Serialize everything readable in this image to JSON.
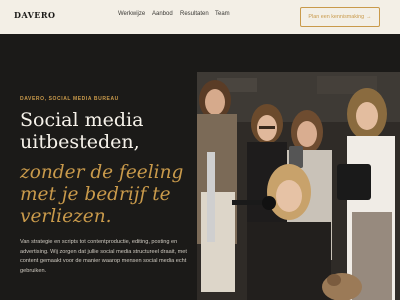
{
  "header": {
    "logo": "DAVERO",
    "nav": [
      "Werkwijze",
      "Aanbod",
      "Resultaten",
      "Team"
    ],
    "cta_label": "Plan een kennismaking",
    "cta_arrow": "→"
  },
  "hero": {
    "eyebrow": "DAVERO, SOCIAL MEDIA BUREAU",
    "heading_line1": "Social media",
    "heading_line2": "uitbesteden,",
    "heading_line3": "zonder de feeling",
    "heading_line4": "met je bedrijf te",
    "heading_line5": "verliezen.",
    "body": "Van strategie en scripts tot contentproductie, editing, posting en advertising. Wij zorgen dat jullie social media structureel draait, met content gemaakt voor de manier waarop mensen social media echt gebruiken."
  },
  "colors": {
    "dark_bg": "#1b1a18",
    "header_bg": "#f3efe6",
    "accent_gold": "#c99a4b",
    "heading_white": "#f6f2ea"
  },
  "icons": {
    "cta_arrow": "arrow-right-icon",
    "photo": "team-photo"
  }
}
